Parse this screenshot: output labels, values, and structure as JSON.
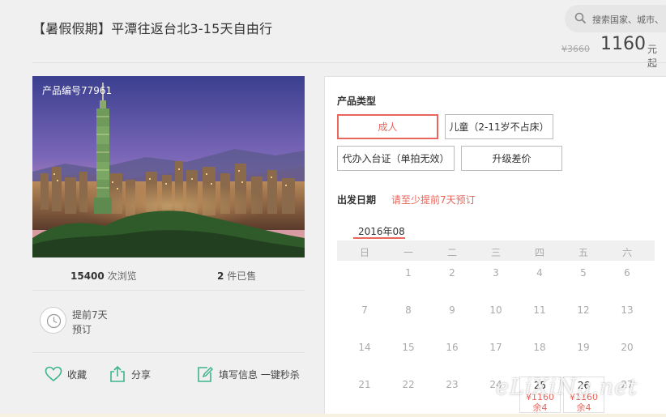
{
  "header": {
    "title": "【暑假假期】平潭往返台北3-15天自由行",
    "search_placeholder": "搜索国家、城市、",
    "price_old": "¥3660",
    "price_now": "1160",
    "price_unit": "元起"
  },
  "product": {
    "code_label": "产品编号77961",
    "views_count": "15400",
    "views_label": "次浏览",
    "sold_count": "2",
    "sold_label": "件已售",
    "advance_line1": "提前7天",
    "advance_line2": "预订"
  },
  "actions": {
    "favorite": "收藏",
    "share": "分享",
    "fill_info": "填写信息 一键秒杀"
  },
  "booking": {
    "type_label": "产品类型",
    "types": [
      "成人",
      "儿童（2-11岁不占床）",
      "代办入台证（单拍无效）",
      "升级差价"
    ],
    "selected_type": "成人",
    "date_label": "出发日期",
    "date_hint": "请至少提前7天预订",
    "month": "2016年08",
    "weekdays": [
      "日",
      "一",
      "二",
      "三",
      "四",
      "五",
      "六"
    ],
    "rows": [
      [
        "",
        "1",
        "2",
        "3",
        "4",
        "5",
        "6"
      ],
      [
        "7",
        "8",
        "9",
        "10",
        "11",
        "12",
        "13"
      ],
      [
        "14",
        "15",
        "16",
        "17",
        "18",
        "19",
        "20"
      ],
      [
        "21",
        "22",
        "23",
        "24",
        "25",
        "26",
        "27"
      ]
    ],
    "available": [
      {
        "day": "25",
        "price": "¥1160",
        "remain": "余4"
      },
      {
        "day": "26",
        "price": "¥1160",
        "remain": "余4"
      }
    ]
  },
  "watermark": "eLiXiNg.net",
  "colors": {
    "accent": "#e8665c",
    "icon_green": "#3cb48c",
    "background": "#f0f0f0"
  }
}
